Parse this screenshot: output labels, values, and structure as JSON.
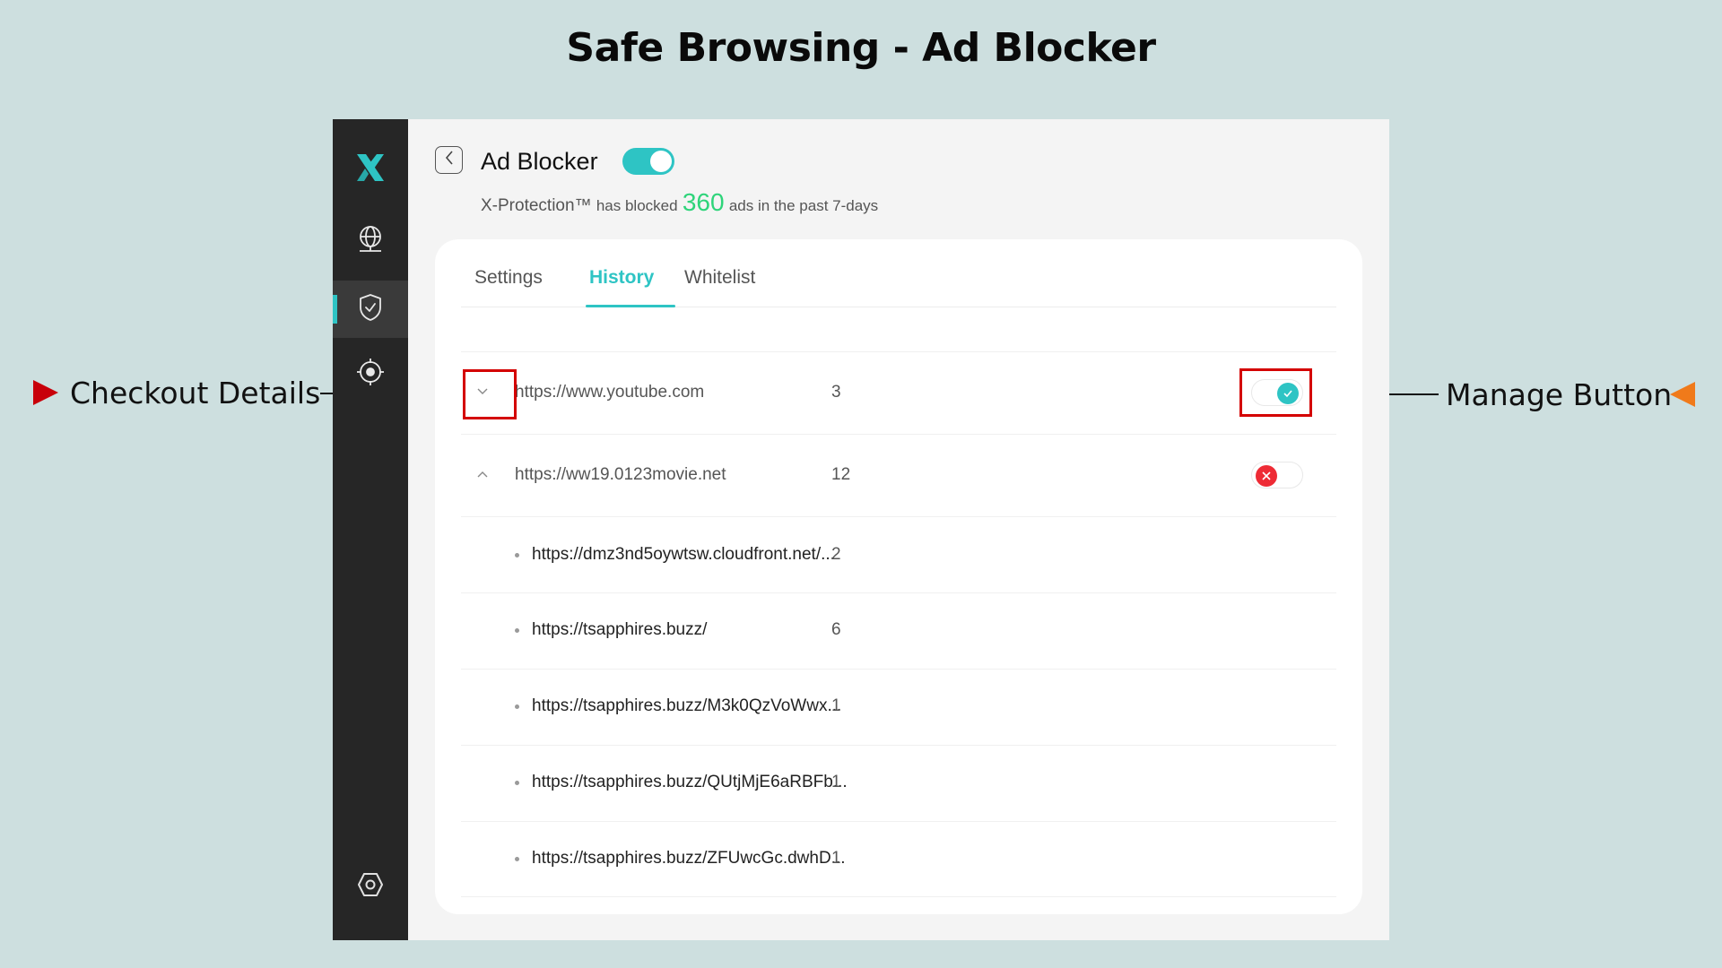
{
  "page_title": "Safe Browsing - Ad Blocker",
  "annotations": {
    "left": {
      "label": "Checkout Details",
      "marker_color": "#c8000a"
    },
    "right": {
      "label": "Manage Button",
      "marker_color": "#f07a1a"
    },
    "highlight_color": "#d40000"
  },
  "sidebar": {
    "logo": "x-logo-icon",
    "items": [
      {
        "icon": "globe-icon",
        "active": false
      },
      {
        "icon": "shield-check-icon",
        "active": true
      },
      {
        "icon": "crosshair-icon",
        "active": false
      }
    ],
    "bottom_item": {
      "icon": "settings-hexagon-icon"
    },
    "accent_color": "#2ec4c4"
  },
  "header": {
    "back_icon": "chevron-left-icon",
    "title": "Ad Blocker",
    "enabled": true,
    "subtitle_prefix": "X-Protection™",
    "subtitle_mid": "has blocked",
    "blocked_count": "360",
    "subtitle_suffix": "ads in the past 7-days",
    "count_color": "#2ed47a"
  },
  "tabs": [
    {
      "label": "Settings",
      "active": false
    },
    {
      "label": "History",
      "active": true
    },
    {
      "label": "Whitelist",
      "active": false
    }
  ],
  "history": [
    {
      "type": "parent",
      "url": "https://www.youtube.com",
      "count": "3",
      "expanded": false,
      "expand_icon": "chevron-down-icon",
      "blocking": true
    },
    {
      "type": "parent",
      "url": "https://ww19.0123movie.net",
      "count": "12",
      "expanded": true,
      "expand_icon": "chevron-up-icon",
      "blocking": false
    },
    {
      "type": "child",
      "url": "https://dmz3nd5oywtsw.cloudfront.net/...",
      "count": "2"
    },
    {
      "type": "child",
      "url": "https://tsapphires.buzz/",
      "count": "6"
    },
    {
      "type": "child",
      "url": "https://tsapphires.buzz/M3k0QzVoWwx...",
      "count": "1"
    },
    {
      "type": "child",
      "url": "https://tsapphires.buzz/QUtjMjE6aRBFb...",
      "count": "1"
    },
    {
      "type": "child",
      "url": "https://tsapphires.buzz/ZFUwcGc.dwhD...",
      "count": "1"
    }
  ]
}
